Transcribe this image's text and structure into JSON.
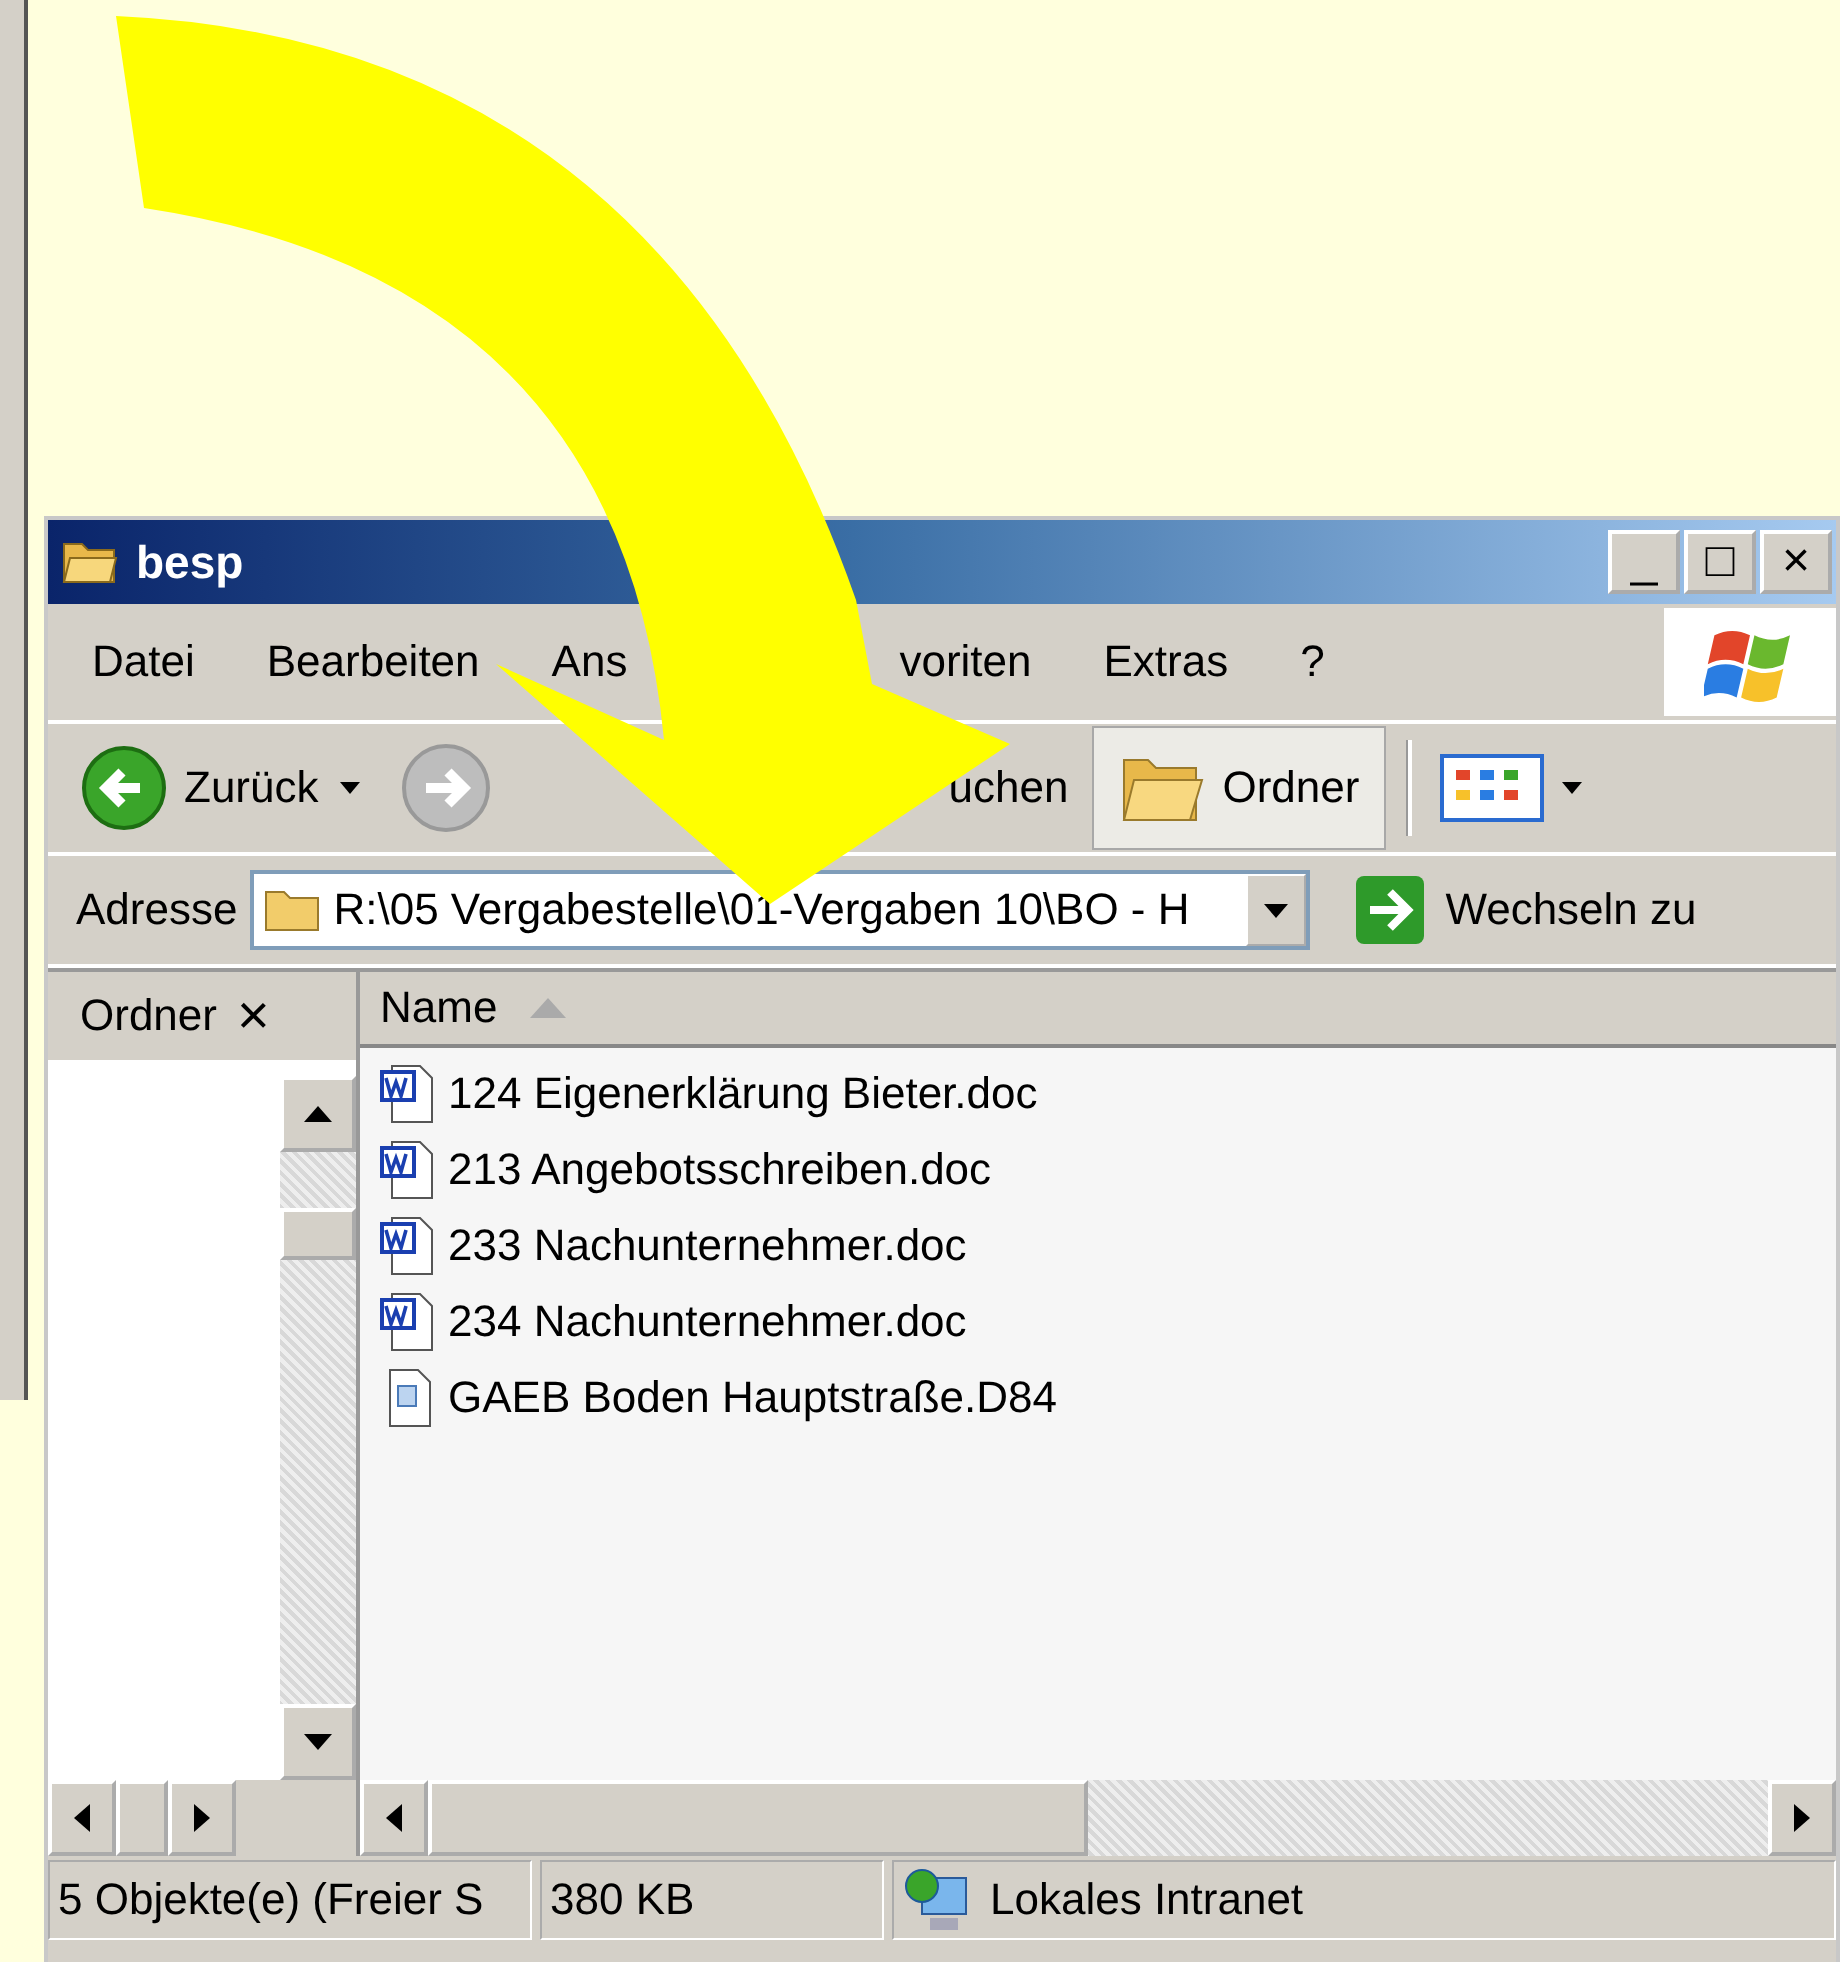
{
  "window": {
    "title": "besp",
    "buttons": [
      "_",
      "□",
      "×"
    ]
  },
  "menu": [
    {
      "label": "Datei"
    },
    {
      "label": "Bearbeiten"
    },
    {
      "label": "Ans"
    },
    {
      "label": "voriten"
    },
    {
      "label": "Extras"
    },
    {
      "label": "?"
    }
  ],
  "toolbar": {
    "back": {
      "label": "Zurück",
      "disabled": false
    },
    "forward": {
      "disabled": true
    },
    "search": {
      "label": "uchen"
    },
    "folders": {
      "label": "Ordner",
      "selected": true
    }
  },
  "address": {
    "label": "Adresse",
    "value": "R:\\05 Vergabestelle\\01-Vergaben 10\\BO - H",
    "go": "Wechseln zu"
  },
  "folder_pane": {
    "title": "Ordner",
    "close": "×"
  },
  "file_list": {
    "columns": [
      {
        "label": "Name",
        "sorted": true
      }
    ],
    "files": [
      {
        "name": "124 Eigenerklärung Bieter.doc",
        "kind": "word"
      },
      {
        "name": "213 Angebotsschreiben.doc",
        "kind": "word"
      },
      {
        "name": "233 Nachunternehmer.doc",
        "kind": "word"
      },
      {
        "name": "234 Nachunternehmer.doc",
        "kind": "word"
      },
      {
        "name": "GAEB Boden Hauptstraße.D84",
        "kind": "generic"
      }
    ]
  },
  "status_bar": [
    {
      "text": "5 Objekte(e) (Freier S"
    },
    {
      "text": "380 KB"
    },
    {
      "text": "Lokales Intranet",
      "kind": "zone"
    }
  ]
}
